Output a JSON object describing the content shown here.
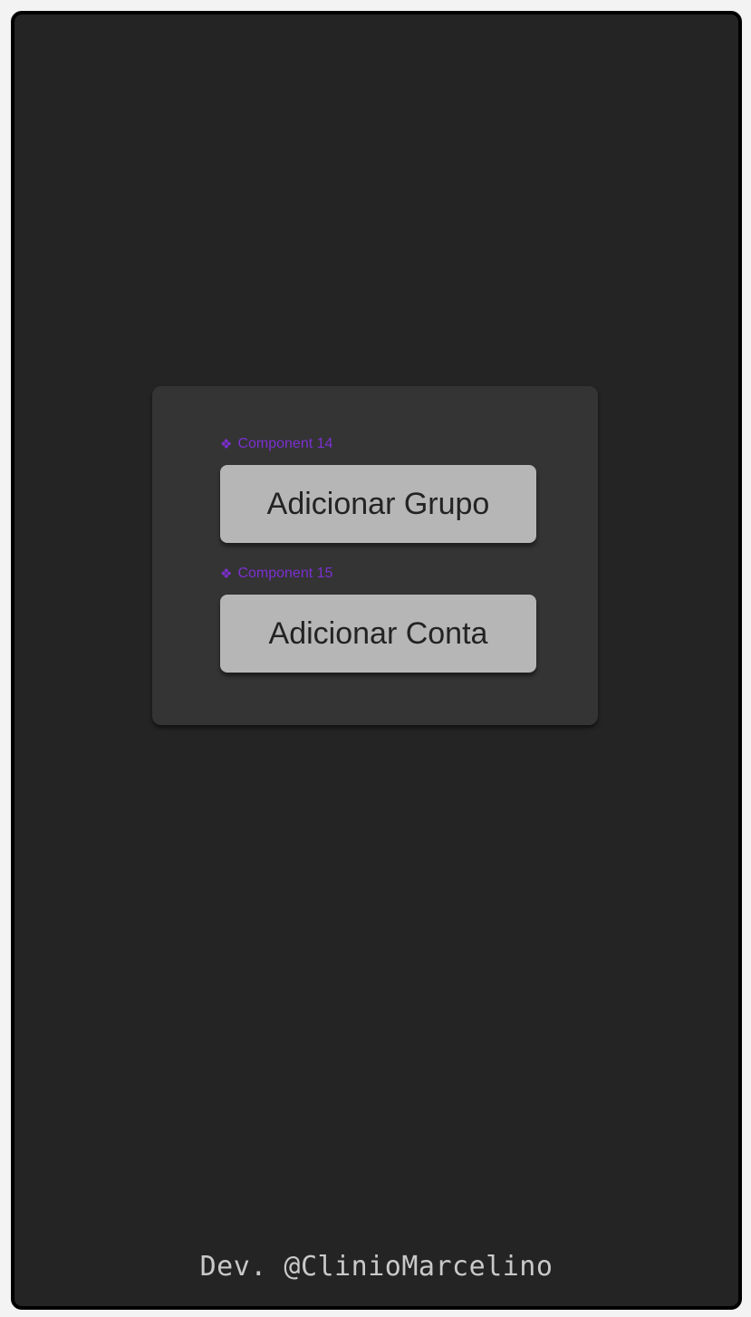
{
  "panel": {
    "components": [
      {
        "label": "Component 14",
        "icon": "component-diamond-icon",
        "button_label": "Adicionar Grupo"
      },
      {
        "label": "Component 15",
        "icon": "component-diamond-icon",
        "button_label": "Adicionar Conta"
      }
    ],
    "icon_glyph": "❖"
  },
  "footer": {
    "text": "Dev. @ClinioMarcelino"
  },
  "colors": {
    "background": "#242424",
    "panel": "#343434",
    "button": "#b6b6b6",
    "component_label": "#7b2fd0",
    "footer_text": "#c9c9c9"
  }
}
